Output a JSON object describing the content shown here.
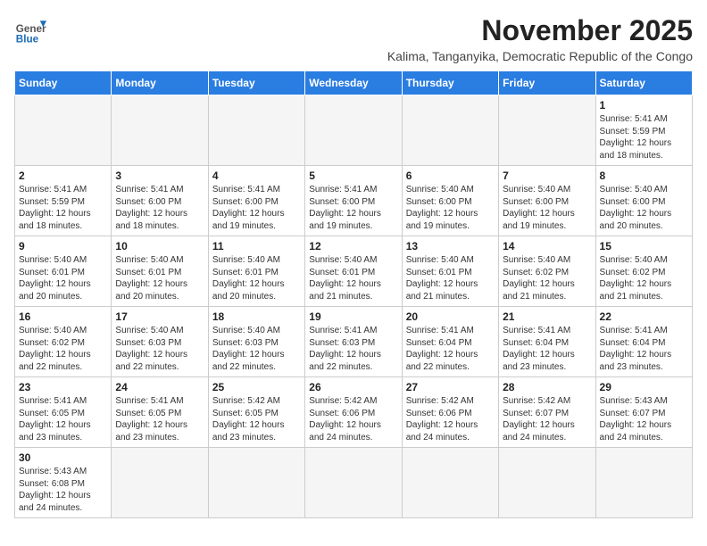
{
  "header": {
    "logo_general": "General",
    "logo_blue": "Blue",
    "month_year": "November 2025",
    "location": "Kalima, Tanganyika, Democratic Republic of the Congo"
  },
  "days_of_week": [
    "Sunday",
    "Monday",
    "Tuesday",
    "Wednesday",
    "Thursday",
    "Friday",
    "Saturday"
  ],
  "weeks": [
    [
      {
        "day": "",
        "info": ""
      },
      {
        "day": "",
        "info": ""
      },
      {
        "day": "",
        "info": ""
      },
      {
        "day": "",
        "info": ""
      },
      {
        "day": "",
        "info": ""
      },
      {
        "day": "",
        "info": ""
      },
      {
        "day": "1",
        "info": "Sunrise: 5:41 AM\nSunset: 5:59 PM\nDaylight: 12 hours\nand 18 minutes."
      }
    ],
    [
      {
        "day": "2",
        "info": "Sunrise: 5:41 AM\nSunset: 5:59 PM\nDaylight: 12 hours\nand 18 minutes."
      },
      {
        "day": "3",
        "info": "Sunrise: 5:41 AM\nSunset: 6:00 PM\nDaylight: 12 hours\nand 18 minutes."
      },
      {
        "day": "4",
        "info": "Sunrise: 5:41 AM\nSunset: 6:00 PM\nDaylight: 12 hours\nand 19 minutes."
      },
      {
        "day": "5",
        "info": "Sunrise: 5:41 AM\nSunset: 6:00 PM\nDaylight: 12 hours\nand 19 minutes."
      },
      {
        "day": "6",
        "info": "Sunrise: 5:40 AM\nSunset: 6:00 PM\nDaylight: 12 hours\nand 19 minutes."
      },
      {
        "day": "7",
        "info": "Sunrise: 5:40 AM\nSunset: 6:00 PM\nDaylight: 12 hours\nand 19 minutes."
      },
      {
        "day": "8",
        "info": "Sunrise: 5:40 AM\nSunset: 6:00 PM\nDaylight: 12 hours\nand 20 minutes."
      }
    ],
    [
      {
        "day": "9",
        "info": "Sunrise: 5:40 AM\nSunset: 6:01 PM\nDaylight: 12 hours\nand 20 minutes."
      },
      {
        "day": "10",
        "info": "Sunrise: 5:40 AM\nSunset: 6:01 PM\nDaylight: 12 hours\nand 20 minutes."
      },
      {
        "day": "11",
        "info": "Sunrise: 5:40 AM\nSunset: 6:01 PM\nDaylight: 12 hours\nand 20 minutes."
      },
      {
        "day": "12",
        "info": "Sunrise: 5:40 AM\nSunset: 6:01 PM\nDaylight: 12 hours\nand 21 minutes."
      },
      {
        "day": "13",
        "info": "Sunrise: 5:40 AM\nSunset: 6:01 PM\nDaylight: 12 hours\nand 21 minutes."
      },
      {
        "day": "14",
        "info": "Sunrise: 5:40 AM\nSunset: 6:02 PM\nDaylight: 12 hours\nand 21 minutes."
      },
      {
        "day": "15",
        "info": "Sunrise: 5:40 AM\nSunset: 6:02 PM\nDaylight: 12 hours\nand 21 minutes."
      }
    ],
    [
      {
        "day": "16",
        "info": "Sunrise: 5:40 AM\nSunset: 6:02 PM\nDaylight: 12 hours\nand 22 minutes."
      },
      {
        "day": "17",
        "info": "Sunrise: 5:40 AM\nSunset: 6:03 PM\nDaylight: 12 hours\nand 22 minutes."
      },
      {
        "day": "18",
        "info": "Sunrise: 5:40 AM\nSunset: 6:03 PM\nDaylight: 12 hours\nand 22 minutes."
      },
      {
        "day": "19",
        "info": "Sunrise: 5:41 AM\nSunset: 6:03 PM\nDaylight: 12 hours\nand 22 minutes."
      },
      {
        "day": "20",
        "info": "Sunrise: 5:41 AM\nSunset: 6:04 PM\nDaylight: 12 hours\nand 22 minutes."
      },
      {
        "day": "21",
        "info": "Sunrise: 5:41 AM\nSunset: 6:04 PM\nDaylight: 12 hours\nand 23 minutes."
      },
      {
        "day": "22",
        "info": "Sunrise: 5:41 AM\nSunset: 6:04 PM\nDaylight: 12 hours\nand 23 minutes."
      }
    ],
    [
      {
        "day": "23",
        "info": "Sunrise: 5:41 AM\nSunset: 6:05 PM\nDaylight: 12 hours\nand 23 minutes."
      },
      {
        "day": "24",
        "info": "Sunrise: 5:41 AM\nSunset: 6:05 PM\nDaylight: 12 hours\nand 23 minutes."
      },
      {
        "day": "25",
        "info": "Sunrise: 5:42 AM\nSunset: 6:05 PM\nDaylight: 12 hours\nand 23 minutes."
      },
      {
        "day": "26",
        "info": "Sunrise: 5:42 AM\nSunset: 6:06 PM\nDaylight: 12 hours\nand 24 minutes."
      },
      {
        "day": "27",
        "info": "Sunrise: 5:42 AM\nSunset: 6:06 PM\nDaylight: 12 hours\nand 24 minutes."
      },
      {
        "day": "28",
        "info": "Sunrise: 5:42 AM\nSunset: 6:07 PM\nDaylight: 12 hours\nand 24 minutes."
      },
      {
        "day": "29",
        "info": "Sunrise: 5:43 AM\nSunset: 6:07 PM\nDaylight: 12 hours\nand 24 minutes."
      }
    ],
    [
      {
        "day": "30",
        "info": "Sunrise: 5:43 AM\nSunset: 6:08 PM\nDaylight: 12 hours\nand 24 minutes."
      },
      {
        "day": "",
        "info": ""
      },
      {
        "day": "",
        "info": ""
      },
      {
        "day": "",
        "info": ""
      },
      {
        "day": "",
        "info": ""
      },
      {
        "day": "",
        "info": ""
      },
      {
        "day": "",
        "info": ""
      }
    ]
  ]
}
